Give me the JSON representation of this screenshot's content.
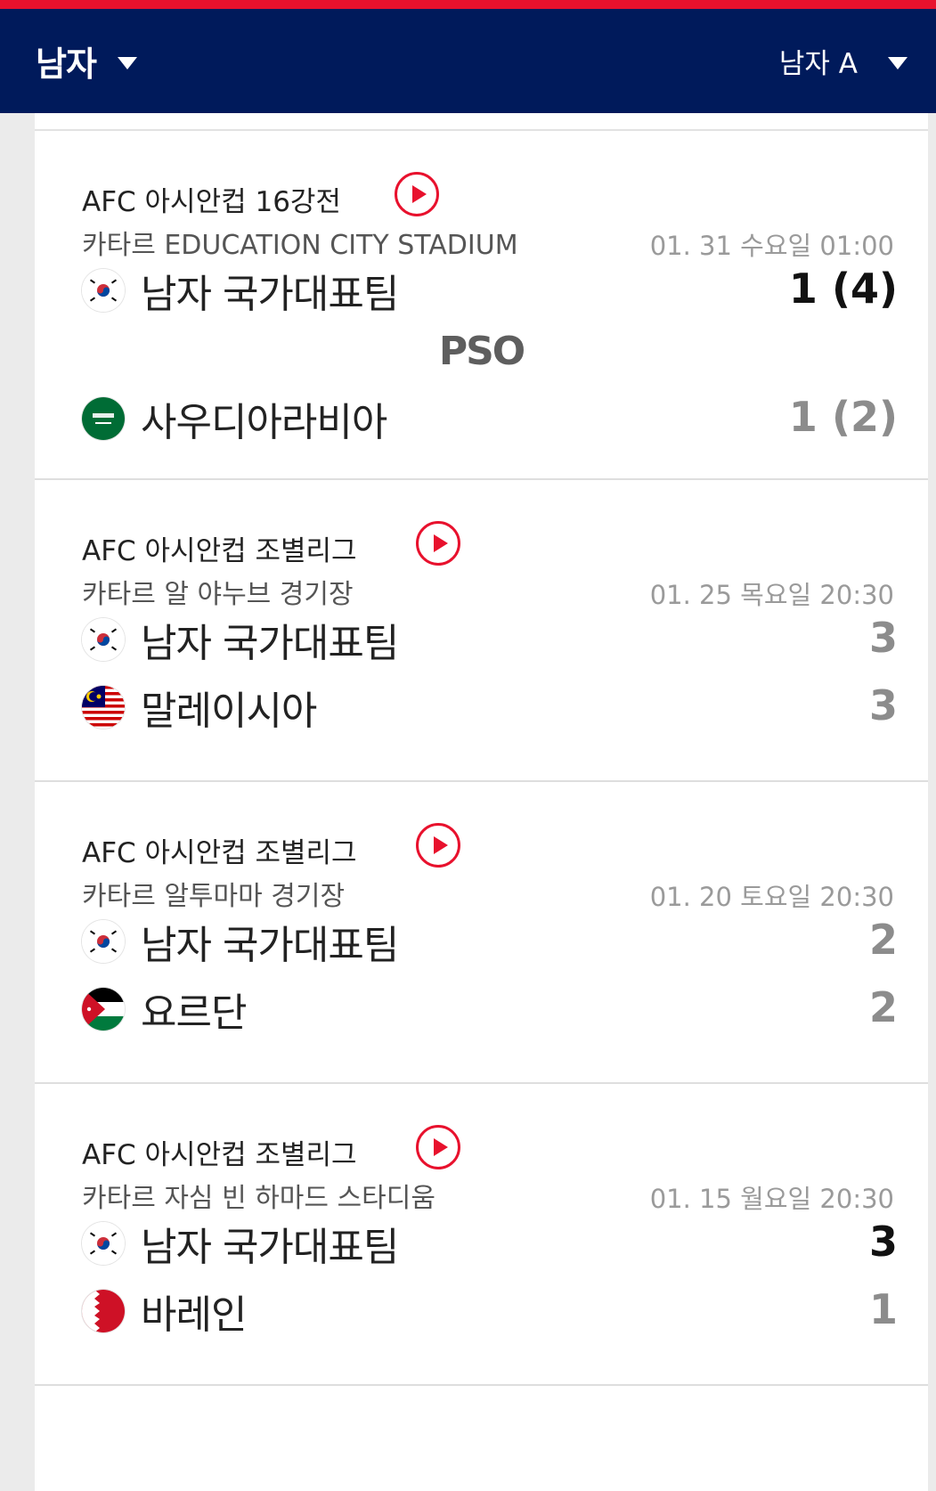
{
  "header": {
    "left_label": "남자",
    "right_label": "남자 A",
    "background": "#001a5b",
    "accent": "#e8112d"
  },
  "matches": [
    {
      "competition": "AFC 아시안컵 16강전",
      "venue": "카타르 EDUCATION CITY STADIUM",
      "datetime": "01. 31 수요일 01:00",
      "pso_label": "PSO",
      "home": {
        "name": "남자 국가대표팀",
        "flag": "korea-flag-icon",
        "score": "1 (4)",
        "result": "win"
      },
      "away": {
        "name": "사우디아라비아",
        "flag": "saudi-arabia-flag-icon",
        "score": "1 (2)",
        "result": "lose"
      }
    },
    {
      "competition": "AFC 아시안컵 조별리그",
      "venue": "카타르 알 야누브 경기장",
      "datetime": "01. 25 목요일 20:30",
      "home": {
        "name": "남자 국가대표팀",
        "flag": "korea-flag-icon",
        "score": "3",
        "result": "draw"
      },
      "away": {
        "name": "말레이시아",
        "flag": "malaysia-flag-icon",
        "score": "3",
        "result": "draw"
      }
    },
    {
      "competition": "AFC 아시안컵 조별리그",
      "venue": "카타르 알투마마 경기장",
      "datetime": "01. 20 토요일 20:30",
      "home": {
        "name": "남자 국가대표팀",
        "flag": "korea-flag-icon",
        "score": "2",
        "result": "draw"
      },
      "away": {
        "name": "요르단",
        "flag": "jordan-flag-icon",
        "score": "2",
        "result": "draw"
      }
    },
    {
      "competition": "AFC 아시안컵 조별리그",
      "venue": "카타르 자심 빈 하마드 스타디움",
      "datetime": "01. 15 월요일 20:30",
      "home": {
        "name": "남자 국가대표팀",
        "flag": "korea-flag-icon",
        "score": "3",
        "result": "win"
      },
      "away": {
        "name": "바레인",
        "flag": "bahrain-flag-icon",
        "score": "1",
        "result": "lose"
      }
    }
  ]
}
